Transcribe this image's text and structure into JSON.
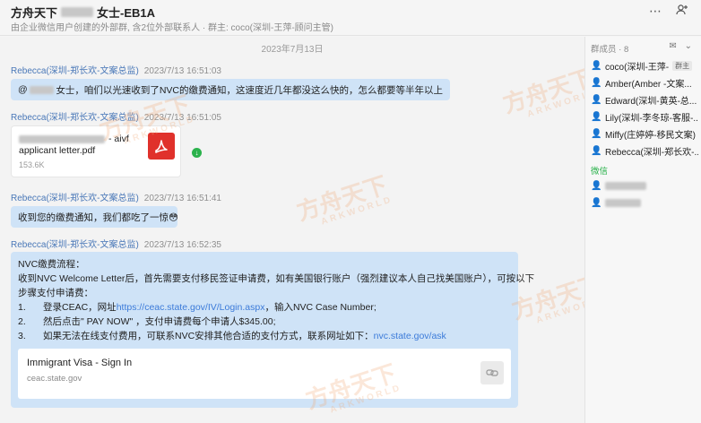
{
  "header": {
    "title_prefix": "方舟天下",
    "title_suffix": "女士-EB1A",
    "subtitle": "由企业微信用户创建的外部群, 含2位外部联系人 · 群主: coco(深圳-王萍-顾问主管)",
    "more_icon": "ellipsis-icon",
    "add_member_icon": "add-member-icon"
  },
  "chat": {
    "date": "2023年7月13日",
    "messages": [
      {
        "sender": "Rebecca(深圳-郑长欢-文案总监)",
        "time": "2023/7/13 16:51:03",
        "mention": "@",
        "text": "女士，咱们以光速收到了NVC的缴费通知，这速度近几年都没这么快的，怎么都要等半年以上"
      },
      {
        "sender": "Rebecca(深圳-郑长欢-文案总监)",
        "time": "2023/7/13 16:51:05",
        "file": {
          "name_suffix": "- aivf",
          "name_line2": "applicant letter.pdf",
          "size": "153.6K",
          "icon": "pdf-icon"
        }
      },
      {
        "sender": "Rebecca(深圳-郑长欢-文案总监)",
        "time": "2023/7/13 16:51:41",
        "text": "收到您的缴费通知，我们都吃了一惊",
        "emoji": "😳"
      },
      {
        "sender": "Rebecca(深圳-郑长欢-文案总监)",
        "time": "2023/7/13 16:52:35",
        "lines": {
          "l1": "NVC缴费流程：",
          "l2": "收到NVC Welcome Letter后，首先需要支付移民签证申请费，如有美国银行账户（强烈建议本人自己找美国账户），可按以下",
          "l3": "步骤支付申请费：",
          "s1_num": "1.",
          "s1_a": "登录CEAC，网址",
          "s1_link": "https://ceac.state.gov/IV/Login.aspx",
          "s1_b": "，输入NVC Case Number;",
          "s2_num": "2.",
          "s2_a": "然后点击\" PAY NOW\" ，支付申请费每个申请人$345.00;",
          "s3_num": "3.",
          "s3_a": "如果无法在线支付费用，可联系NVC安排其他合适的支付方式，联系网址如下：",
          "s3_link": "nvc.state.gov/ask"
        },
        "link_card": {
          "title": "Immigrant Visa - Sign In",
          "domain": "ceac.state.gov",
          "icon": "link-preview-icon"
        }
      }
    ],
    "watermark_cn": "方舟天下",
    "watermark_en": "ARKWORLD"
  },
  "panel": {
    "members_label": "群成员 · 8",
    "members": [
      {
        "name": "coco(深圳-王萍-",
        "tag": "群主",
        "icon": "owner-avatar-icon"
      },
      {
        "name": "Amber(Amber -文案...",
        "icon": "user-avatar-icon"
      },
      {
        "name": "Edward(深圳-黄英-总...",
        "icon": "user-avatar-icon"
      },
      {
        "name": "Lily(深圳-李冬琼-客服-...",
        "icon": "user-avatar-icon"
      },
      {
        "name": "Miffy(庄婷婷-移民文案)",
        "icon": "user-avatar-icon"
      },
      {
        "name": "Rebecca(深圳-郑长欢-...",
        "icon": "user-avatar-icon"
      }
    ],
    "wechat_label": "微信"
  }
}
